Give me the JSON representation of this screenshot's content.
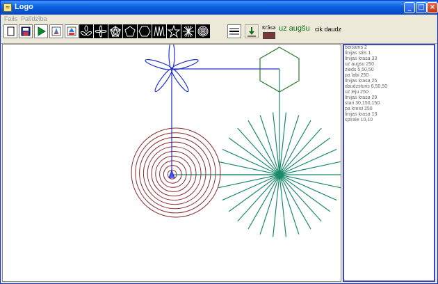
{
  "window": {
    "title": "Logo",
    "minimize_glyph": "_",
    "maximize_glyph": "□",
    "close_glyph": "×"
  },
  "menu": [
    "Fails",
    "Palīdzība"
  ],
  "toolbar": {
    "color_label": "Krāsa",
    "color_value": "#7b3737",
    "command_big": "uz augšu",
    "command_small": "cik daudz",
    "buttons": [
      "new-icon",
      "save-icon",
      "run-icon",
      "step-icon",
      "export-icon",
      "trefoil-icon",
      "six-petal-flower-icon",
      "pentagon-star-icon",
      "pentagon-icon",
      "hexagon-icon",
      "zigzag-icon",
      "star-outline-icon",
      "asterisk-icon",
      "spiral-icon",
      "stripes-icon",
      "arrow-down-icon"
    ]
  },
  "commands": [
    "beisams 2",
    "linijas stils 1",
    "linijas krasa 33",
    "uz augsu 250",
    "zieds 5,50,50",
    "pa labi 250",
    "linijas krasa 25",
    "daudzsturis 6,50,50",
    "uz leju 250",
    "linijas krasa 29",
    "stari 30,150,150",
    "pa kreisi 250",
    "linijas krasa 13",
    "spirale 10,10"
  ]
}
